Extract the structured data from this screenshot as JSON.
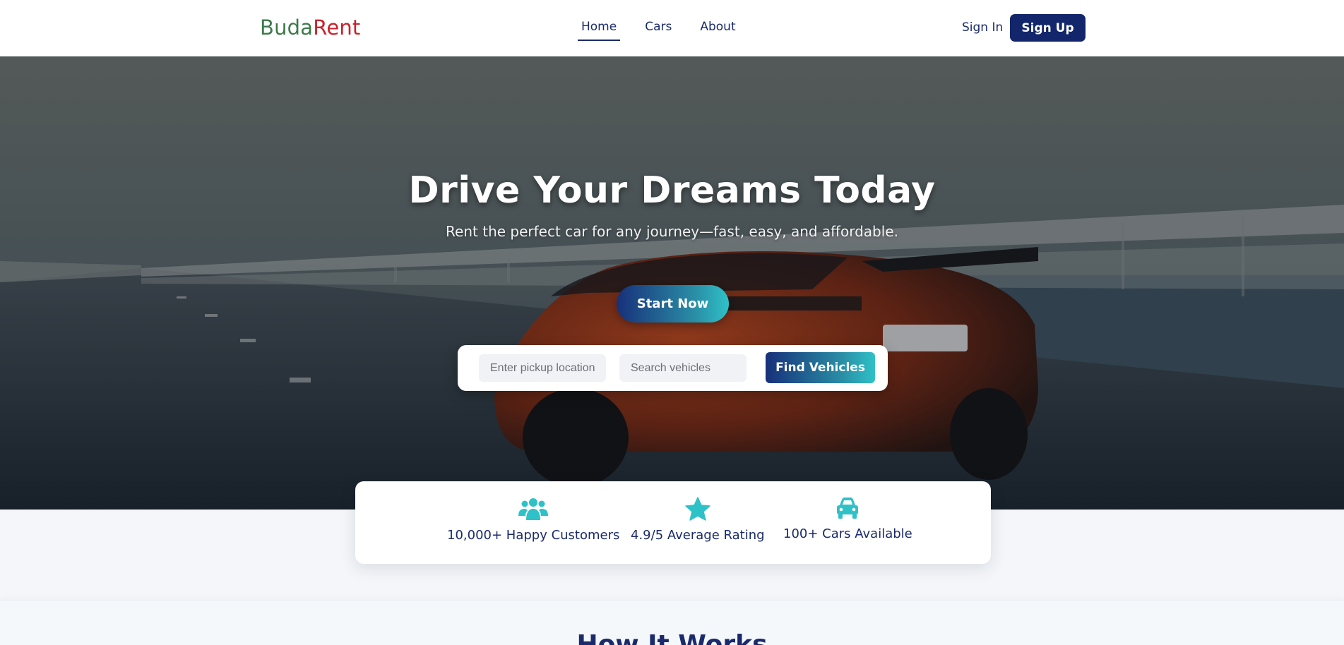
{
  "brand": {
    "part1": "Buda",
    "part2": "Rent"
  },
  "nav": {
    "links": [
      {
        "label": "Home",
        "active": true
      },
      {
        "label": "Cars",
        "active": false
      },
      {
        "label": "About",
        "active": false
      }
    ],
    "signin": "Sign In",
    "signup": "Sign Up"
  },
  "hero": {
    "title": "Drive Your Dreams Today",
    "subtitle": "Rent the perfect car for any journey—fast, easy, and affordable.",
    "cta": "Start Now"
  },
  "search": {
    "pickup_placeholder": "Enter pickup location",
    "vehicles_placeholder": "Search vehicles",
    "button": "Find Vehicles"
  },
  "stats": [
    {
      "icon": "users-icon",
      "label": "10,000+ Happy Customers"
    },
    {
      "icon": "star-icon",
      "label": "4.9/5 Average Rating"
    },
    {
      "icon": "car-icon",
      "label": "100+ Cars Available"
    }
  ],
  "how_it_works": {
    "title": "How It Works"
  },
  "colors": {
    "primary": "#13266b",
    "accent": "#2fc1c8",
    "logo_green": "#3d7a4a",
    "logo_red": "#c8232c"
  }
}
